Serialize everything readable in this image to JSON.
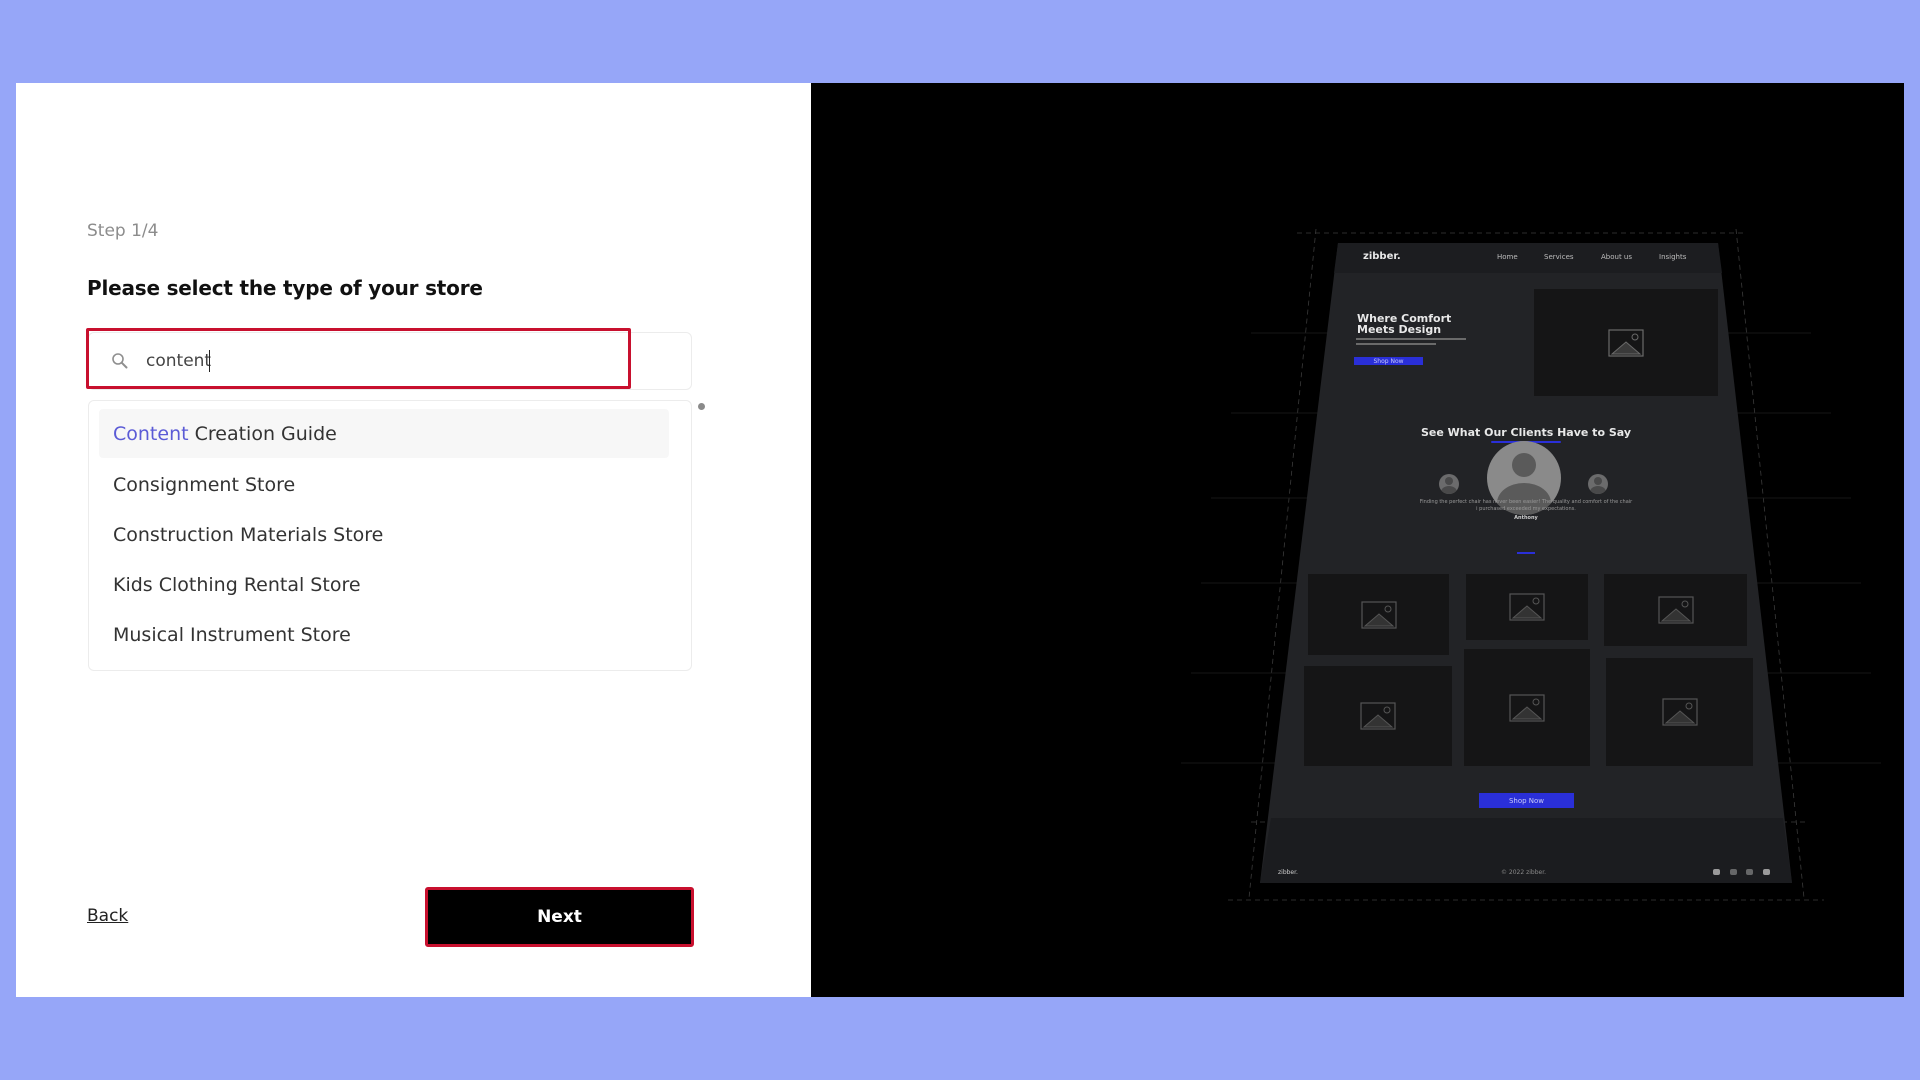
{
  "wizard": {
    "step_label": "Step 1/4",
    "heading": "Please select the type of your store",
    "search": {
      "value": "content",
      "icon": "search-icon"
    },
    "options": [
      {
        "match": "Content",
        "rest": " Creation Guide",
        "highlighted": true
      },
      {
        "match": "",
        "rest": "Consignment Store",
        "highlighted": false
      },
      {
        "match": "",
        "rest": "Construction Materials Store",
        "highlighted": false
      },
      {
        "match": "",
        "rest": "Kids Clothing Rental Store",
        "highlighted": false
      },
      {
        "match": "",
        "rest": "Musical Instrument Store",
        "highlighted": false
      }
    ],
    "back_label": "Back",
    "next_label": "Next"
  },
  "colors": {
    "background": "#96a6f8",
    "highlight_border": "#c8102e",
    "match_text": "#5b5bd6",
    "mockup_accent": "#2a2fd8"
  },
  "preview": {
    "logo": "zibber.",
    "nav": [
      "Home",
      "Services",
      "About us",
      "Insights"
    ],
    "hero_title_line1": "Where Comfort",
    "hero_title_line2": "Meets Design",
    "hero_button": "Shop Now",
    "testimonials_heading": "See What Our Clients Have to Say",
    "testimonial_quote_line1": "Finding the perfect chair has never been easier! The quality and comfort of the chair",
    "testimonial_quote_line2": "i purchased exceeded my expectations.",
    "testimonial_name": "Anthony",
    "cta_button": "Shop Now",
    "footer_logo": "zibber.",
    "footer_copyright": "© 2022 zibber.",
    "social_icons": [
      "twitter-icon",
      "instagram-icon",
      "github-icon",
      "youtube-icon"
    ]
  }
}
